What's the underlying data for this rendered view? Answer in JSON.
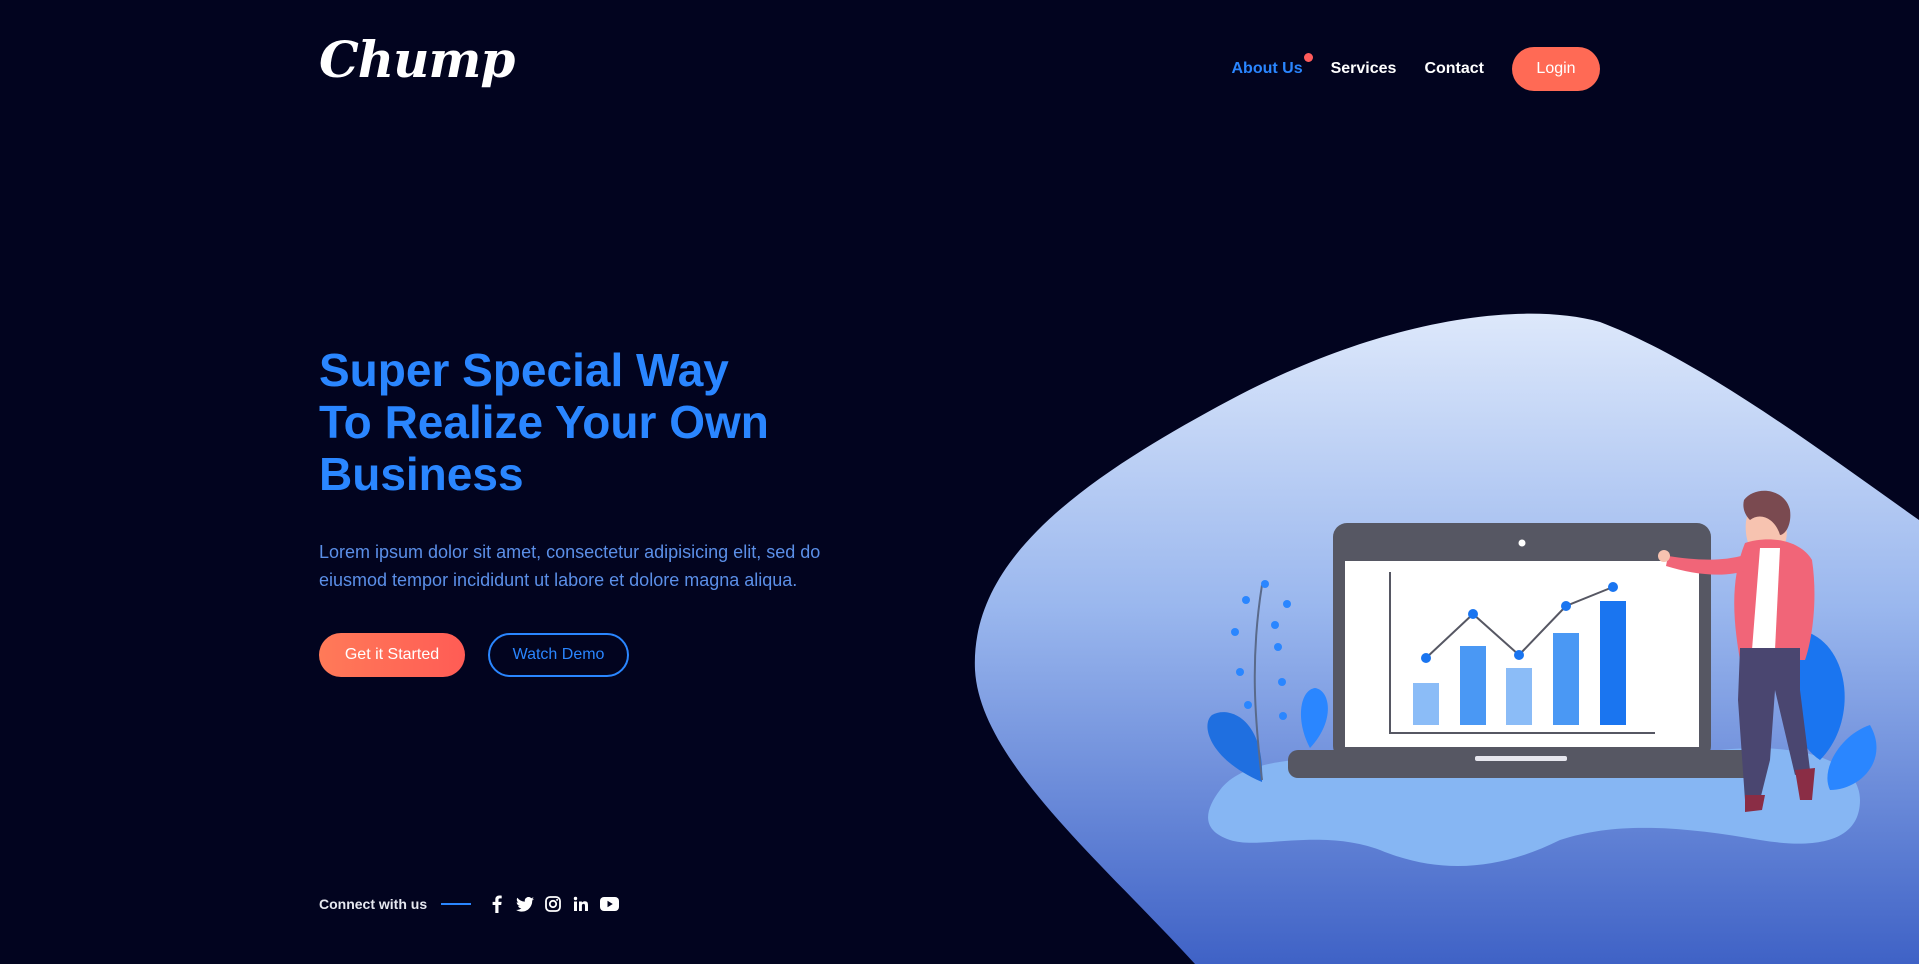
{
  "brand": {
    "logo_text": "Chump"
  },
  "nav": {
    "items": [
      {
        "label": "About Us",
        "active": true
      },
      {
        "label": "Services",
        "active": false
      },
      {
        "label": "Contact",
        "active": false
      }
    ],
    "login_label": "Login"
  },
  "hero": {
    "title_line1": "Super Special Way",
    "title_line2": "To Realize Your Own",
    "title_line3": "Business",
    "description": "Lorem ipsum dolor sit amet, consectetur adipisicing elit, sed do eiusmod tempor incididunt ut labore et dolore magna aliqua.",
    "primary_button": "Get it Started",
    "secondary_button": "Watch Demo"
  },
  "social": {
    "label": "Connect with us",
    "icons": [
      "facebook-icon",
      "twitter-icon",
      "instagram-icon",
      "linkedin-icon",
      "youtube-icon"
    ]
  },
  "colors": {
    "background": "#02041f",
    "accent": "#2a86ff",
    "button_primary": "#ff6a55",
    "notification_dot": "#ff5b5b"
  }
}
